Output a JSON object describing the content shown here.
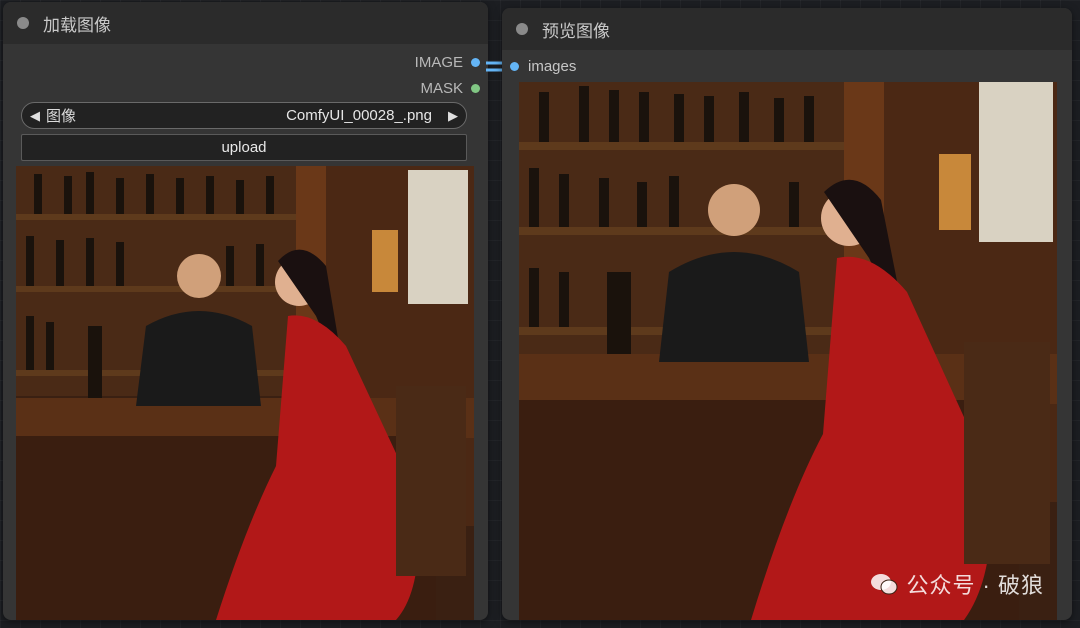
{
  "load_node": {
    "title": "加载图像",
    "outputs": [
      {
        "label": "IMAGE",
        "color": "#64b5f6"
      },
      {
        "label": "MASK",
        "color": "#81c784"
      }
    ],
    "image_widget": {
      "label": "图像",
      "value": "ComfyUI_00028_.png",
      "prev": "◀",
      "next": "▶"
    },
    "upload_label": "upload",
    "image_icon": "photo-bar-scene"
  },
  "preview_node": {
    "title": "预览图像",
    "input_label": "images",
    "image_icon": "photo-bar-scene"
  },
  "watermark": {
    "text": "公众号 · 破狼",
    "icon": "wechat-icon"
  },
  "colors": {
    "canvas": "#1c1e22",
    "node_body": "#353535",
    "node_header": "#2b2b2b",
    "image_slot": "#64b5f6",
    "mask_slot": "#81c784"
  }
}
